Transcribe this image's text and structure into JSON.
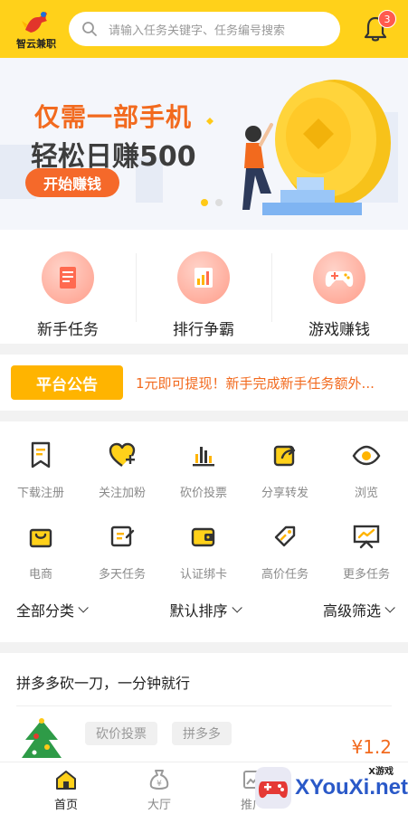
{
  "header": {
    "logo_text": "智云兼职",
    "search_placeholder": "请输入任务关键字、任务编号搜索",
    "notification_count": "3"
  },
  "banner": {
    "line1": "仅需一部手机",
    "line2": "轻松日赚500",
    "button": "开始赚钱",
    "slides": 2,
    "active_slide": 1
  },
  "quick": [
    {
      "label": "新手任务",
      "icon": "clipboard-icon"
    },
    {
      "label": "排行争霸",
      "icon": "chart-icon"
    },
    {
      "label": "游戏赚钱",
      "icon": "gamepad-icon"
    }
  ],
  "notice": {
    "tag": "平台公告",
    "text": "1元即可提现！新手完成新手任务额外..."
  },
  "categories": [
    {
      "label": "下载注册",
      "icon": "download-bookmark-icon"
    },
    {
      "label": "关注加粉",
      "icon": "heart-plus-icon"
    },
    {
      "label": "砍价投票",
      "icon": "bar-chart-icon"
    },
    {
      "label": "分享转发",
      "icon": "share-icon"
    },
    {
      "label": "浏览",
      "icon": "eye-icon"
    },
    {
      "label": "电商",
      "icon": "shopping-bag-icon"
    },
    {
      "label": "多天任务",
      "icon": "edit-note-icon"
    },
    {
      "label": "认证绑卡",
      "icon": "wallet-icon"
    },
    {
      "label": "高价任务",
      "icon": "price-tag-icon"
    },
    {
      "label": "更多任务",
      "icon": "presentation-icon"
    }
  ],
  "filters": [
    "全部分类",
    "默认排序",
    "高级筛选"
  ],
  "task": {
    "title": "拼多多砍一刀，一分钟就行",
    "tags": [
      "砍价投票",
      "拼多多"
    ],
    "price": "¥1.2"
  },
  "tabbar": [
    {
      "label": "首页",
      "icon": "home-icon",
      "active": true
    },
    {
      "label": "大厅",
      "icon": "money-bag-icon",
      "active": false
    },
    {
      "label": "推广",
      "icon": "image-icon",
      "active": false
    }
  ],
  "watermark": {
    "text": "XYouXi.net",
    "small": "X游戏"
  },
  "colors": {
    "brand_yellow": "#ffd11a",
    "accent_orange": "#f26a1e",
    "badge_red": "#ff5a4e"
  }
}
